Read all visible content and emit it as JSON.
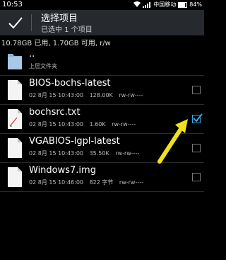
{
  "status": {
    "time": "10:53",
    "carrier": "中国移动",
    "battery": "84%"
  },
  "actionbar": {
    "title": "选择项目",
    "subtitle": "已选中 1 个项目"
  },
  "storage_text": "10.78GB 已用, 1.70GB 可用, r/w",
  "files": [
    {
      "name": "..",
      "date": "上层文件夹",
      "size": "",
      "perm": "",
      "type": "folder",
      "checked": null
    },
    {
      "name": "BIOS-bochs-latest",
      "date": "02 8月 15 10:43:00",
      "size": "128.00K",
      "perm": "rw-rw----",
      "type": "file",
      "checked": false
    },
    {
      "name": "bochsrc.txt",
      "date": "02 8月 15 10:43:00",
      "size": "1.60K",
      "perm": "rw-rw----",
      "type": "text",
      "checked": true
    },
    {
      "name": "VGABIOS-lgpl-latest",
      "date": "02 8月 15 10:43:00",
      "size": "35.50K",
      "perm": "rw-rw----",
      "type": "file",
      "checked": false
    },
    {
      "name": "Windows7.img",
      "date": "02 8月 15 10:46:00",
      "size": "822 字节",
      "perm": "rw-rw----",
      "type": "file",
      "checked": false
    }
  ],
  "colors": {
    "accent": "#33a7e0",
    "annotation_arrow": "#f2e01c",
    "actionbar": "#262a2f"
  },
  "icons": [
    "checkmark-icon",
    "folder-icon",
    "file-icon",
    "text-file-icon",
    "checkbox-icon",
    "annotation-arrow-icon"
  ]
}
